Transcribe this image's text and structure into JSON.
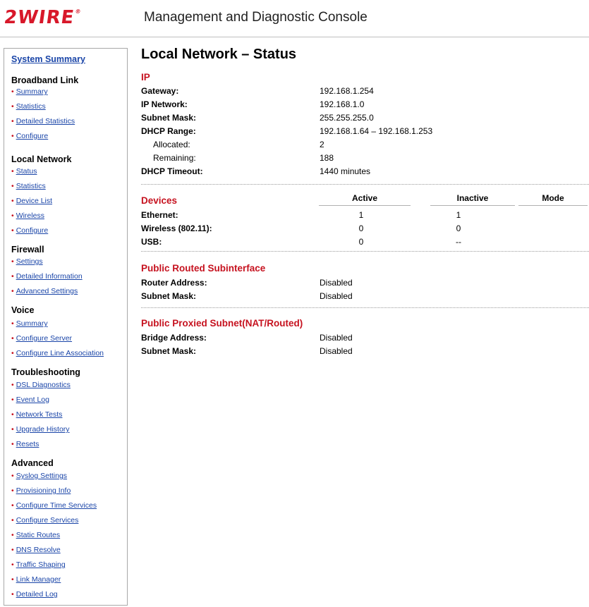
{
  "header": {
    "logo": "2WIRE",
    "logo_mark": "®",
    "title": "Management and Diagnostic Console"
  },
  "sidebar": {
    "system_summary": "System Summary",
    "sections": [
      {
        "title": "Broadband Link",
        "items": [
          "Summary",
          "Statistics",
          "Detailed Statistics",
          "Configure"
        ]
      },
      {
        "title": "Local Network",
        "items": [
          "Status",
          "Statistics",
          "Device List",
          "Wireless",
          "Configure"
        ]
      },
      {
        "title": "Firewall",
        "items": [
          "Settings",
          "Detailed Information",
          "Advanced Settings"
        ]
      },
      {
        "title": "Voice",
        "items": [
          "Summary",
          "Configure Server",
          "Configure Line Association"
        ]
      },
      {
        "title": "Troubleshooting",
        "items": [
          "DSL Diagnostics",
          "Event Log",
          "Network Tests",
          "Upgrade History",
          "Resets"
        ]
      },
      {
        "title": "Advanced",
        "items": [
          "Syslog Settings",
          "Provisioning Info",
          "Configure Time Services",
          "Configure Services",
          "Static Routes",
          "DNS Resolve",
          "Traffic Shaping",
          "Link Manager",
          "Detailed Log"
        ]
      }
    ]
  },
  "main": {
    "page_title": "Local Network – Status",
    "ip": {
      "heading": "IP",
      "rows": [
        {
          "label": "Gateway:",
          "value": "192.168.1.254"
        },
        {
          "label": "IP Network:",
          "value": "192.168.1.0"
        },
        {
          "label": "Subnet Mask:",
          "value": "255.255.255.0"
        },
        {
          "label": "DHCP Range:",
          "value": "192.168.1.64 – 192.168.1.253"
        },
        {
          "label": "Allocated:",
          "value": "2"
        },
        {
          "label": "Remaining:",
          "value": "188"
        },
        {
          "label": "DHCP Timeout:",
          "value": "1440 minutes"
        }
      ]
    },
    "devices": {
      "heading": "Devices",
      "columns": [
        "Active",
        "Inactive",
        "Mode"
      ],
      "rows": [
        {
          "label": "Ethernet:",
          "active": "1",
          "inactive": "1",
          "mode": ""
        },
        {
          "label": "Wireless (802.11):",
          "active": "0",
          "inactive": "0",
          "mode": ""
        },
        {
          "label": "USB:",
          "active": "0",
          "inactive": "--",
          "mode": ""
        }
      ]
    },
    "public_routed": {
      "heading": "Public Routed Subinterface",
      "rows": [
        {
          "label": "Router Address:",
          "value": "Disabled"
        },
        {
          "label": "Subnet Mask:",
          "value": "Disabled"
        }
      ]
    },
    "public_proxied": {
      "heading": "Public Proxied Subnet(NAT/Routed)",
      "rows": [
        {
          "label": "Bridge Address:",
          "value": "Disabled"
        },
        {
          "label": "Subnet Mask:",
          "value": "Disabled"
        }
      ]
    }
  }
}
